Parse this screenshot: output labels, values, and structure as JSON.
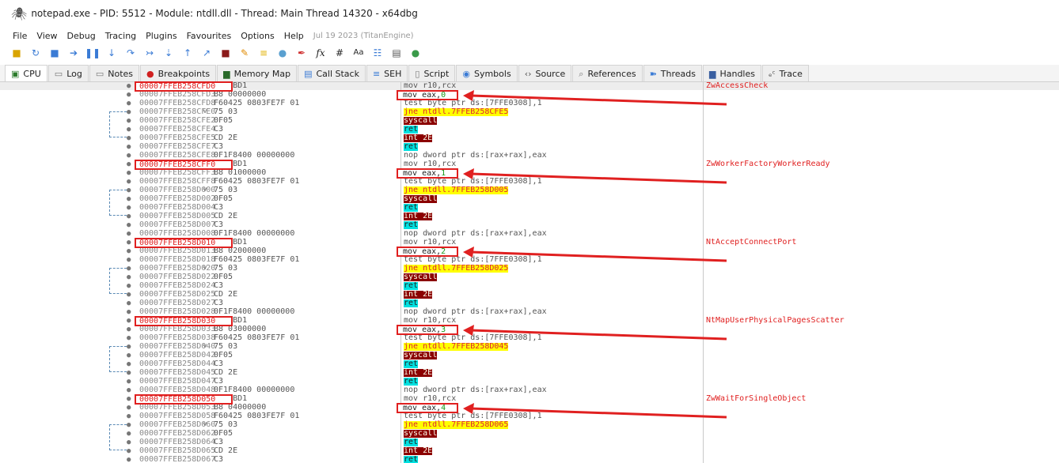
{
  "window": {
    "title": "notepad.exe - PID: 5512 - Module: ntdll.dll - Thread: Main Thread 14320 - x64dbg",
    "icon": "bug-icon"
  },
  "menu": {
    "items": [
      "File",
      "View",
      "Debug",
      "Tracing",
      "Plugins",
      "Favourites",
      "Options",
      "Help"
    ],
    "build": "Jul 19 2023 (TitanEngine)"
  },
  "toolbar": {
    "icons": [
      "open-icon",
      "restart-icon",
      "stop-icon",
      "run-icon",
      "pause-icon",
      "step-into-icon",
      "step-over-icon",
      "trace-into-icon",
      "trace-over-icon",
      "execute-till-return-icon",
      "run-to-user-code-icon",
      "scylla-icon",
      "patch-icon",
      "comment-icon",
      "label-icon",
      "bookmark-icon",
      "function-icon",
      "hash-icon",
      "font-icon",
      "log-icon",
      "script-icon",
      "calc-icon"
    ],
    "fx_label": "fx",
    "hash_label": "#",
    "font_label": "Aa"
  },
  "tabs": [
    {
      "label": "CPU",
      "icon": "cpu-icon",
      "active": true
    },
    {
      "label": "Log",
      "icon": "log-icon",
      "active": false
    },
    {
      "label": "Notes",
      "icon": "notes-icon",
      "active": false
    },
    {
      "label": "Breakpoints",
      "icon": "breakpoint-dot-icon",
      "active": false
    },
    {
      "label": "Memory Map",
      "icon": "memory-map-icon",
      "active": false
    },
    {
      "label": "Call Stack",
      "icon": "call-stack-icon",
      "active": false
    },
    {
      "label": "SEH",
      "icon": "seh-icon",
      "active": false
    },
    {
      "label": "Script",
      "icon": "script-icon",
      "active": false
    },
    {
      "label": "Symbols",
      "icon": "symbols-icon",
      "active": false
    },
    {
      "label": "Source",
      "icon": "source-icon",
      "active": false
    },
    {
      "label": "References",
      "icon": "references-icon",
      "active": false
    },
    {
      "label": "Threads",
      "icon": "threads-icon",
      "active": false
    },
    {
      "label": "Handles",
      "icon": "handles-icon",
      "active": false
    },
    {
      "label": "Trace",
      "icon": "trace-icon",
      "active": false
    }
  ],
  "functions": [
    {
      "comment": "ZwAccessCheck",
      "rows": [
        {
          "addr": "00007FFEB258CFD0",
          "bytes": "4C:8BD1",
          "asm": "mov r10,rcx"
        },
        {
          "addr": "00007FFEB258CFD3",
          "bytes": "B8 00000000",
          "asm": "mov eax,0",
          "mov_num": "0"
        },
        {
          "addr": "00007FFEB258CFD8",
          "bytes": "F60425 0803FE7F 01",
          "asm": "test byte ptr ds:[7FFE0308],1"
        },
        {
          "addr": "00007FFEB258CFE0",
          "bytes": "75 03",
          "asm": "jne ntdll.7FFEB258CFE5"
        },
        {
          "addr": "00007FFEB258CFE2",
          "bytes": "0F05",
          "asm": "syscall"
        },
        {
          "addr": "00007FFEB258CFE4",
          "bytes": "C3",
          "asm": "ret"
        },
        {
          "addr": "00007FFEB258CFE5",
          "bytes": "CD 2E",
          "asm": "int 2E"
        },
        {
          "addr": "00007FFEB258CFE7",
          "bytes": "C3",
          "asm": "ret"
        },
        {
          "addr": "00007FFEB258CFE8",
          "bytes": "0F1F8400 00000000",
          "asm": "nop dword ptr ds:[rax+rax],eax"
        }
      ]
    },
    {
      "comment": "ZwWorkerFactoryWorkerReady",
      "rows": [
        {
          "addr": "00007FFEB258CFF0",
          "bytes": "4C:8BD1",
          "asm": "mov r10,rcx"
        },
        {
          "addr": "00007FFEB258CFF3",
          "bytes": "B8 01000000",
          "asm": "mov eax,1",
          "mov_num": "1"
        },
        {
          "addr": "00007FFEB258CFF8",
          "bytes": "F60425 0803FE7F 01",
          "asm": "test byte ptr ds:[7FFE0308],1"
        },
        {
          "addr": "00007FFEB258D000",
          "bytes": "75 03",
          "asm": "jne ntdll.7FFEB258D005"
        },
        {
          "addr": "00007FFEB258D002",
          "bytes": "0F05",
          "asm": "syscall"
        },
        {
          "addr": "00007FFEB258D004",
          "bytes": "C3",
          "asm": "ret"
        },
        {
          "addr": "00007FFEB258D005",
          "bytes": "CD 2E",
          "asm": "int 2E"
        },
        {
          "addr": "00007FFEB258D007",
          "bytes": "C3",
          "asm": "ret"
        },
        {
          "addr": "00007FFEB258D008",
          "bytes": "0F1F8400 00000000",
          "asm": "nop dword ptr ds:[rax+rax],eax"
        }
      ]
    },
    {
      "comment": "NtAcceptConnectPort",
      "rows": [
        {
          "addr": "00007FFEB258D010",
          "bytes": "4C:8BD1",
          "asm": "mov r10,rcx"
        },
        {
          "addr": "00007FFEB258D013",
          "bytes": "B8 02000000",
          "asm": "mov eax,2",
          "mov_num": "2"
        },
        {
          "addr": "00007FFEB258D018",
          "bytes": "F60425 0803FE7F 01",
          "asm": "test byte ptr ds:[7FFE0308],1"
        },
        {
          "addr": "00007FFEB258D020",
          "bytes": "75 03",
          "asm": "jne ntdll.7FFEB258D025"
        },
        {
          "addr": "00007FFEB258D022",
          "bytes": "0F05",
          "asm": "syscall"
        },
        {
          "addr": "00007FFEB258D024",
          "bytes": "C3",
          "asm": "ret"
        },
        {
          "addr": "00007FFEB258D025",
          "bytes": "CD 2E",
          "asm": "int 2E"
        },
        {
          "addr": "00007FFEB258D027",
          "bytes": "C3",
          "asm": "ret"
        },
        {
          "addr": "00007FFEB258D028",
          "bytes": "0F1F8400 00000000",
          "asm": "nop dword ptr ds:[rax+rax],eax"
        }
      ]
    },
    {
      "comment": "NtMapUserPhysicalPagesScatter",
      "rows": [
        {
          "addr": "00007FFEB258D030",
          "bytes": "4C:8BD1",
          "asm": "mov r10,rcx"
        },
        {
          "addr": "00007FFEB258D033",
          "bytes": "B8 03000000",
          "asm": "mov eax,3",
          "mov_num": "3"
        },
        {
          "addr": "00007FFEB258D038",
          "bytes": "F60425 0803FE7F 01",
          "asm": "test byte ptr ds:[7FFE0308],1"
        },
        {
          "addr": "00007FFEB258D040",
          "bytes": "75 03",
          "asm": "jne ntdll.7FFEB258D045"
        },
        {
          "addr": "00007FFEB258D042",
          "bytes": "0F05",
          "asm": "syscall"
        },
        {
          "addr": "00007FFEB258D044",
          "bytes": "C3",
          "asm": "ret"
        },
        {
          "addr": "00007FFEB258D045",
          "bytes": "CD 2E",
          "asm": "int 2E"
        },
        {
          "addr": "00007FFEB258D047",
          "bytes": "C3",
          "asm": "ret"
        },
        {
          "addr": "00007FFEB258D048",
          "bytes": "0F1F8400 00000000",
          "asm": "nop dword ptr ds:[rax+rax],eax"
        }
      ]
    },
    {
      "comment": "ZwWaitForSingleObject",
      "rows": [
        {
          "addr": "00007FFEB258D050",
          "bytes": "4C:8BD1",
          "asm": "mov r10,rcx"
        },
        {
          "addr": "00007FFEB258D053",
          "bytes": "B8 04000000",
          "asm": "mov eax,4",
          "mov_num": "4"
        },
        {
          "addr": "00007FFEB258D058",
          "bytes": "F60425 0803FE7F 01",
          "asm": "test byte ptr ds:[7FFE0308],1"
        },
        {
          "addr": "00007FFEB258D060",
          "bytes": "75 03",
          "asm": "jne ntdll.7FFEB258D065"
        },
        {
          "addr": "00007FFEB258D062",
          "bytes": "0F05",
          "asm": "syscall"
        },
        {
          "addr": "00007FFEB258D064",
          "bytes": "C3",
          "asm": "ret"
        },
        {
          "addr": "00007FFEB258D065",
          "bytes": "CD 2E",
          "asm": "int 2E"
        },
        {
          "addr": "00007FFEB258D067",
          "bytes": "C3",
          "asm": "ret"
        }
      ]
    }
  ],
  "colors": {
    "annotation_red": "#e02020",
    "syscall_bg": "#8b0000",
    "jne_highlight": "#ffff00",
    "ret_highlight": "#00e0e0"
  }
}
